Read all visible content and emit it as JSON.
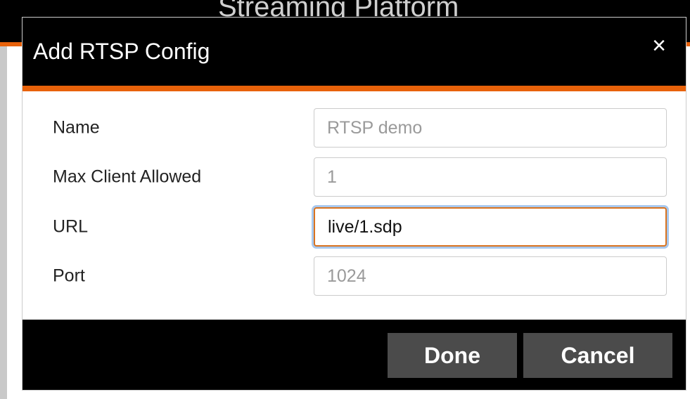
{
  "background": {
    "title": "Streaming Platform"
  },
  "modal": {
    "title": "Add RTSP Config",
    "close_icon": "×",
    "fields": [
      {
        "label": "Name",
        "placeholder": "RTSP demo",
        "value": ""
      },
      {
        "label": "Max Client Allowed",
        "placeholder": "1",
        "value": ""
      },
      {
        "label": "URL",
        "placeholder": "",
        "value": "live/1.sdp"
      },
      {
        "label": "Port",
        "placeholder": "1024",
        "value": ""
      }
    ],
    "buttons": {
      "done": "Done",
      "cancel": "Cancel"
    }
  },
  "colors": {
    "header_bg": "#000000",
    "accent": "#e8620a",
    "button_bg": "#4b4b4b",
    "focus_ring": "#a8c8ee"
  },
  "icons": {
    "close": "close-icon"
  }
}
